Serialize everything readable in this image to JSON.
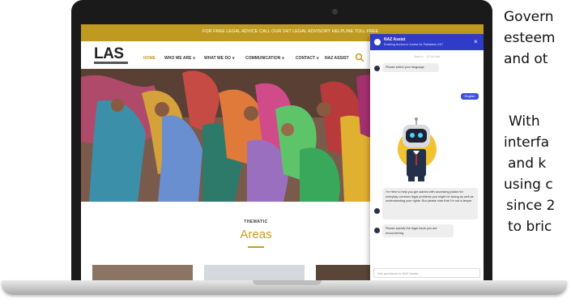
{
  "site": {
    "topbar_text": "FOR FREE LEGAL ADVICE CALL OUR 24/7 LEGAL ADVISORY HELPLINE TOLL FREE",
    "logo": "LAS",
    "nav": [
      "HOME",
      "WHO WE ARE ∨",
      "WHAT WE DO ∨",
      "COMMUNICATION ∨",
      "CONTACT ∨",
      "NAZ ASSIST"
    ],
    "thematic_label": "THEMATIC",
    "areas_title": "Areas"
  },
  "chat": {
    "name": "NAZ Assist",
    "subtitle": "Enabling Access to Justice for Pakistanis 24/7",
    "close_label": "×",
    "timestamp": "Just in · 12:00 AM",
    "bot_messages": [
      "Please select your language",
      "I'm Here to help you get started with accessing justice for everyday common legal problems you might be facing as well as understanding your rights. But please note that I'm not a lawyer.",
      "Please specify the legal issue you are encountering."
    ],
    "user_message": "English",
    "input_placeholder": "Ask questions to NAZ Assist"
  },
  "side_text": [
    "Govern",
    "esteem",
    "and ot",
    "With",
    "interfa",
    "and k",
    "using c",
    "since 2",
    "to bric"
  ],
  "colors": {
    "gold": "#bf9a21",
    "chat_blue": "#2f3cc7",
    "user_bubble": "#3d4fe0"
  }
}
